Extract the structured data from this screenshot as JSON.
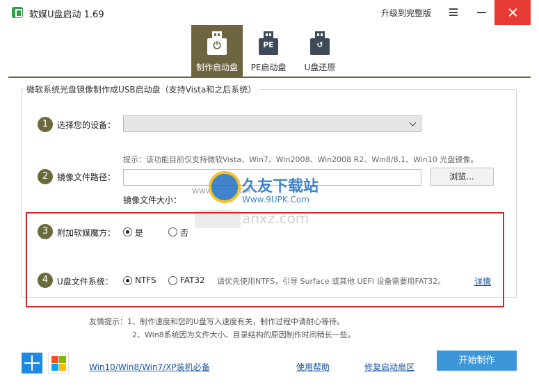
{
  "window": {
    "title": "软媒U盘启动 1.69",
    "upgrade_label": "升级到完整版"
  },
  "tabs": [
    {
      "label": "制作启动盘",
      "icon": "usb-power-icon",
      "active": true
    },
    {
      "label": "PE启动盘",
      "icon": "usb-pe-icon",
      "active": false
    },
    {
      "label": "U盘还原",
      "icon": "usb-restore-icon",
      "active": false
    }
  ],
  "tab_glyphs": {
    "pe": "PE"
  },
  "group": {
    "title": "微软系统光盘镜像制作成USB启动盘（支持Vista和之后系统）"
  },
  "steps": {
    "device": {
      "num": "1",
      "label": "选择您的设备：",
      "value": ""
    },
    "image": {
      "num": "2",
      "label": "镜像文件路径：",
      "hint": "提示：该功能目前仅支持微软Vista、Win7、Win2008、Win2008 R2、Win8/8.1、Win10 光盘镜像。",
      "value": "",
      "browse_label": "浏览...",
      "size_label": "镜像文件大小："
    },
    "magic": {
      "num": "3",
      "label": "附加软媒魔方：",
      "options": [
        "是",
        "否"
      ],
      "selected": "是"
    },
    "fs": {
      "num": "4",
      "label": "U盘文件系统：",
      "options": [
        "NTFS",
        "FAT32"
      ],
      "selected": "NTFS",
      "note": "请优先使用NTFS，引导 Surface 或其他 UEFI 设备需要用FAT32。",
      "detail_label": "详情"
    }
  },
  "watermark": {
    "site_left": "WWW.9UPK.COM",
    "brand": "久友下载站",
    "url": "Www.9UPK.Com",
    "anxz": "anxz.com"
  },
  "tips": {
    "line1": "友情提示：1、制作速度和您的U盘写入速度有关，制作过程中请耐心等待。",
    "line2": "2、Win8系统因为文件大小、目录结构的原因制作时间稍长一些。"
  },
  "footer": {
    "os_link": "Win10/Win8/Win7/XP装机必备",
    "help_link": "使用帮助",
    "repair_link": "修复启动扇区",
    "start_label": "开始制作"
  },
  "colors": {
    "accent": "#6f6440",
    "close": "#e63b34",
    "highlight": "#d9252a",
    "start_button": "#3c96d8",
    "link": "#1a55a8"
  }
}
